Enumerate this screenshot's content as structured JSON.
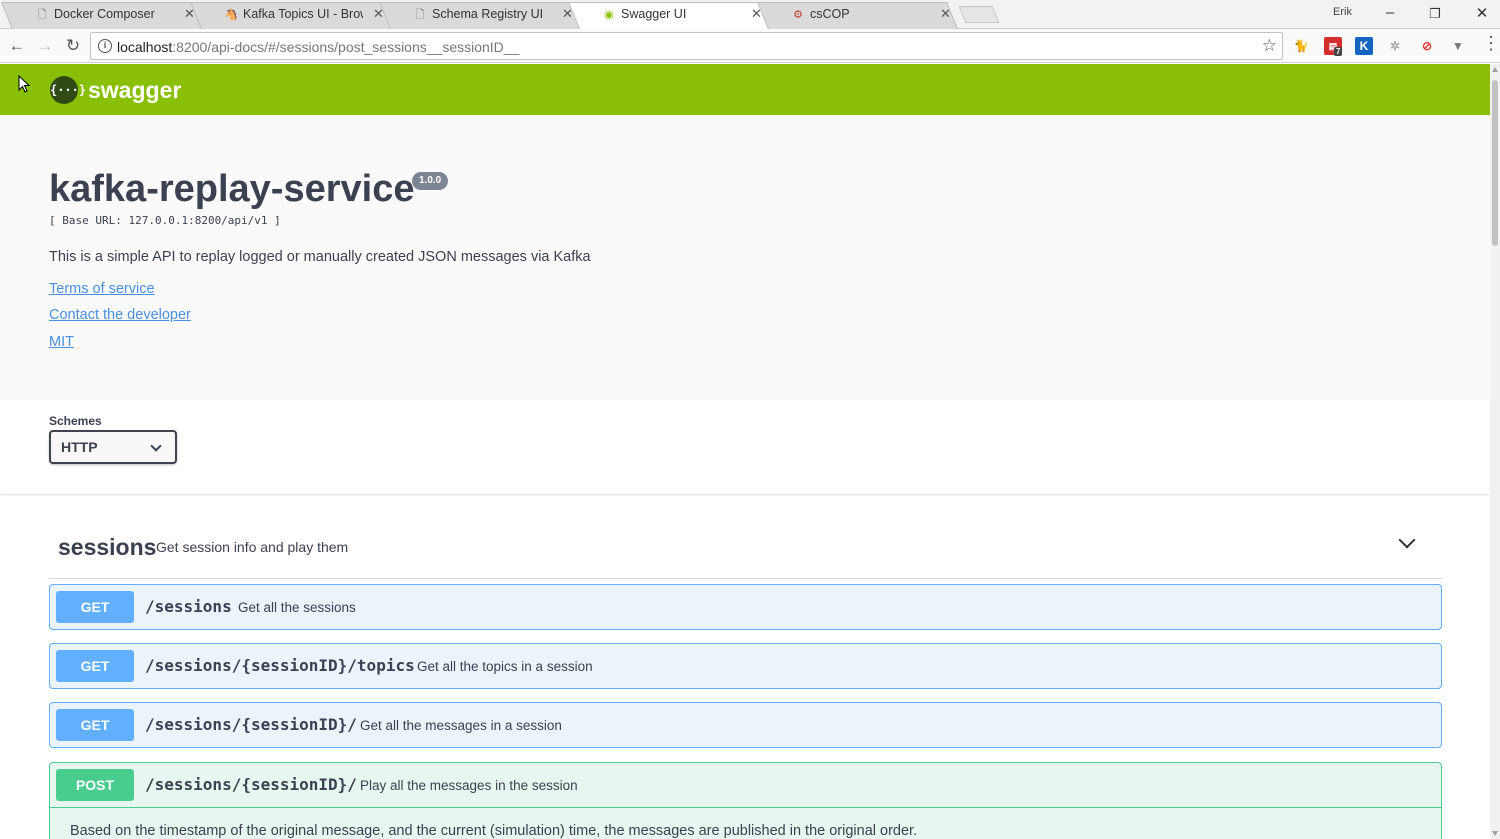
{
  "browser": {
    "tabs": [
      {
        "title": "Docker Composer",
        "icon": "page-icon"
      },
      {
        "title": "Kafka Topics UI - Browse",
        "icon": "kafka-icon"
      },
      {
        "title": "Schema Registry UI",
        "icon": "page-icon"
      },
      {
        "title": "Swagger UI",
        "icon": "swagger-icon"
      },
      {
        "title": "csCOP",
        "icon": "cscop-icon"
      }
    ],
    "active_tab": 3,
    "profile_name": "Erik",
    "url_host": "localhost",
    "url_rest": ":8200/api-docs/#/sessions/post_sessions__sessionID__",
    "extension_badge": "7"
  },
  "swagger": {
    "logo_text": "swagger",
    "logo_glyph": "{···}",
    "brand_color": "#89bf04"
  },
  "info": {
    "title": "kafka-replay-service",
    "version": "1.0.0",
    "base_url": "[ Base URL: 127.0.0.1:8200/api/v1 ]",
    "description": "This is a simple API to replay logged or manually created JSON messages via Kafka",
    "links": {
      "terms": "Terms of service",
      "contact": "Contact the developer",
      "license": "MIT"
    }
  },
  "schemes": {
    "label": "Schemes",
    "selected": "HTTP"
  },
  "tag": {
    "name": "sessions",
    "description": "Get session info and play them"
  },
  "operations": [
    {
      "method": "GET",
      "path": "/sessions",
      "summary": "Get all the sessions"
    },
    {
      "method": "GET",
      "path": "/sessions/{sessionID}/topics",
      "summary": "Get all the topics in a session"
    },
    {
      "method": "GET",
      "path": "/sessions/{sessionID}/",
      "summary": "Get all the messages in a session"
    },
    {
      "method": "POST",
      "path": "/sessions/{sessionID}/",
      "summary": "Play all the messages in the session",
      "description": "Based on the timestamp of the original message, and the current (simulation) time, the messages are published in the original order."
    }
  ],
  "colors": {
    "get": "#61affe",
    "post": "#49cc90",
    "link": "#4990e2",
    "text": "#3b4151"
  }
}
